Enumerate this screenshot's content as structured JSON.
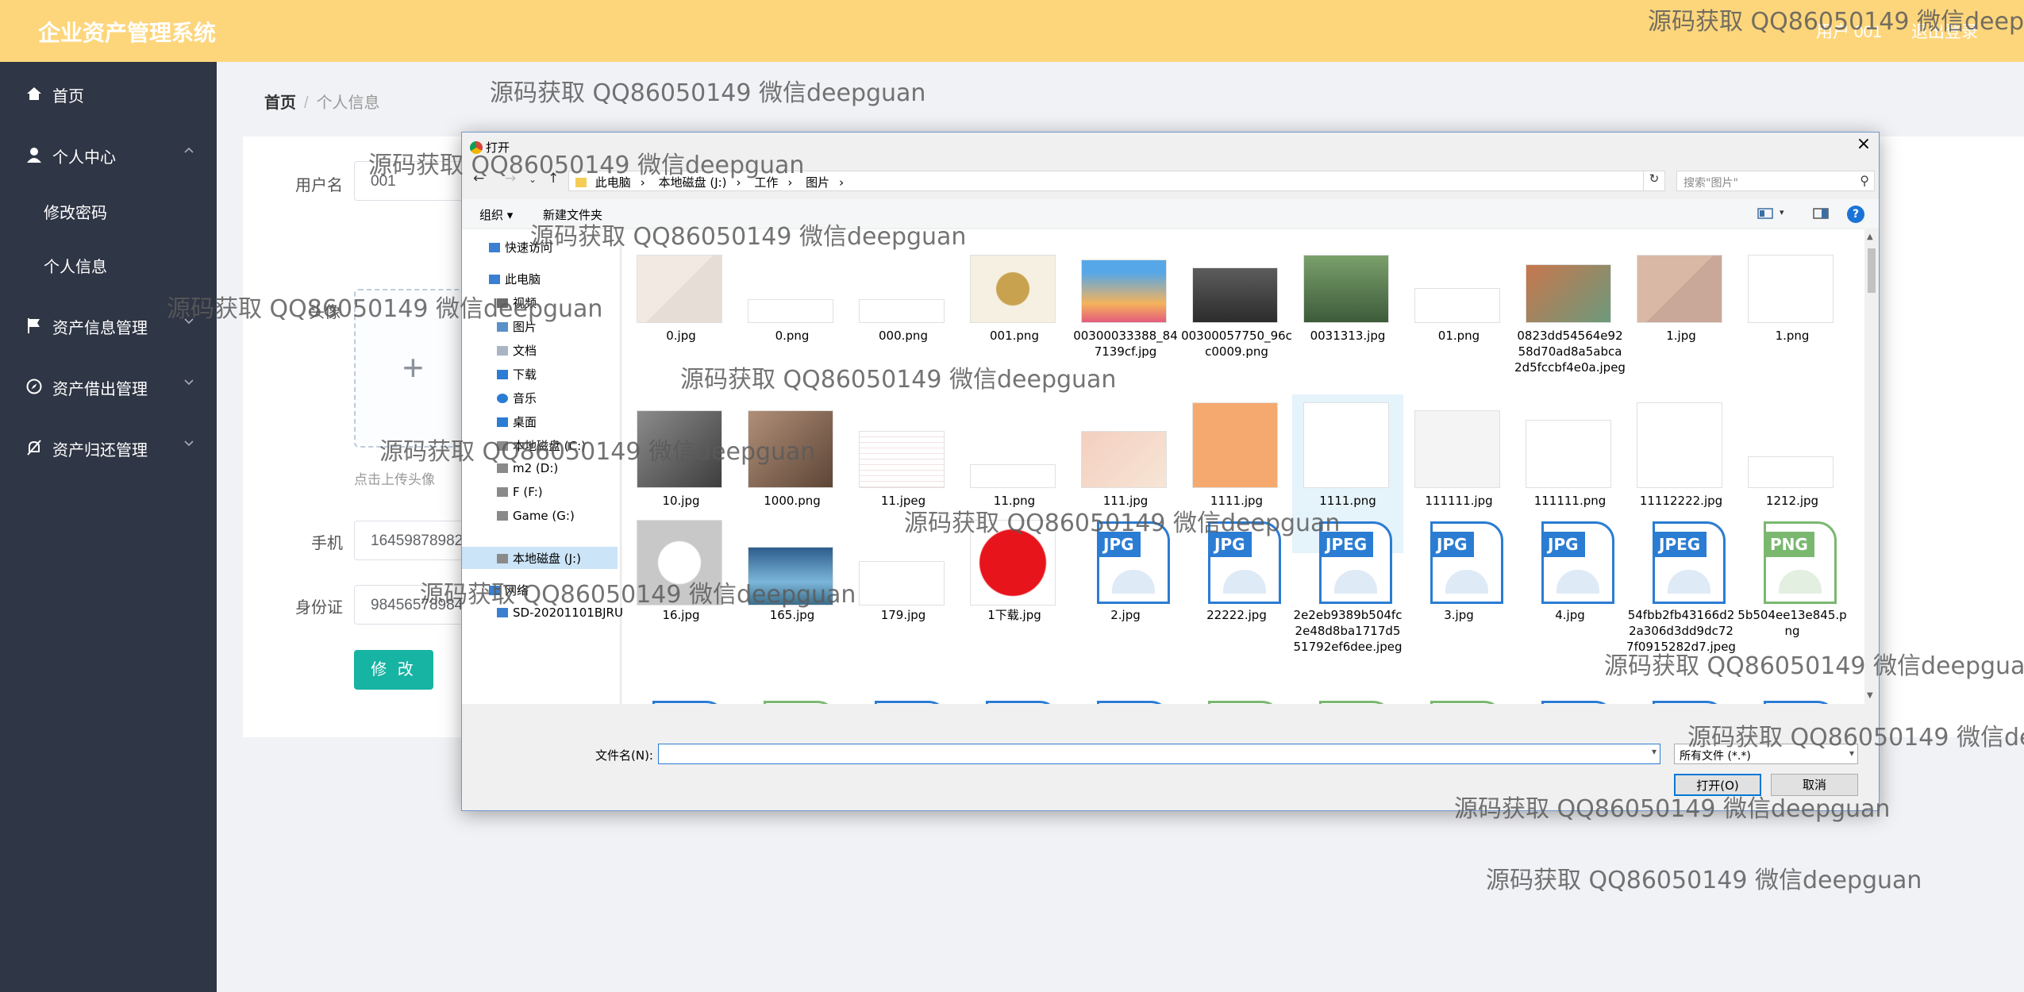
{
  "header": {
    "title": "企业资产管理系统",
    "user": "用户 001",
    "logout": "退出登录"
  },
  "sidebar": {
    "items": [
      {
        "label": "首页"
      },
      {
        "label": "个人中心"
      },
      {
        "label": "修改密码"
      },
      {
        "label": "个人信息"
      },
      {
        "label": "资产信息管理"
      },
      {
        "label": "资产借出管理"
      },
      {
        "label": "资产归还管理"
      }
    ]
  },
  "breadcrumb": {
    "home": "首页",
    "separator": "/",
    "current": "个人信息"
  },
  "form": {
    "username_label": "用户名",
    "username_value": "001",
    "avatar_label": "头像",
    "upload_tip": "点击上传头像",
    "phone_label": "手机",
    "phone_value": "16459878982",
    "id_label": "身份证",
    "id_value": "98456578984",
    "submit_label": "修 改"
  },
  "dialog": {
    "title": "打开",
    "close": "×",
    "path": [
      "此电脑",
      "本地磁盘 (J:)",
      "工作",
      "图片"
    ],
    "search_placeholder": "搜索\"图片\"",
    "toolbar": {
      "organize": "组织 ▾",
      "new_folder": "新建文件夹"
    },
    "nav_pane": [
      {
        "label": "快速访问",
        "icon": "star"
      },
      {
        "label": "此电脑",
        "icon": "computer"
      },
      {
        "label": "视频",
        "icon": "video"
      },
      {
        "label": "图片",
        "icon": "picture"
      },
      {
        "label": "文档",
        "icon": "document"
      },
      {
        "label": "下载",
        "icon": "download"
      },
      {
        "label": "音乐",
        "icon": "music"
      },
      {
        "label": "桌面",
        "icon": "desktop"
      },
      {
        "label": "本地磁盘 (C:)",
        "icon": "drive"
      },
      {
        "label": "m2 (D:)",
        "icon": "drive"
      },
      {
        "label": "F (F:)",
        "icon": "drive"
      },
      {
        "label": "Game (G:)",
        "icon": "drive"
      },
      {
        "label": "本地磁盘 (J:)",
        "icon": "drive"
      },
      {
        "label": "网络",
        "icon": "network"
      },
      {
        "label": "SD-20201101BJRU",
        "icon": "network-computer"
      }
    ],
    "files": [
      {
        "name": "0.jpg",
        "kind": "photo"
      },
      {
        "name": "0.png",
        "kind": "photo"
      },
      {
        "name": "000.png",
        "kind": "photo"
      },
      {
        "name": "001.png",
        "kind": "photo"
      },
      {
        "name": "00300033388_847139cf.jpg",
        "kind": "photo"
      },
      {
        "name": "00300057750_96cc0009.png",
        "kind": "photo"
      },
      {
        "name": "0031313.jpg",
        "kind": "photo"
      },
      {
        "name": "01.png",
        "kind": "photo"
      },
      {
        "name": "0823dd54564e9258d70ad8a5abca2d5fccbf4e0a.jpeg",
        "kind": "photo"
      },
      {
        "name": "1.jpg",
        "kind": "photo"
      },
      {
        "name": "1.png",
        "kind": "photo"
      },
      {
        "name": "10.jpg",
        "kind": "photo"
      },
      {
        "name": "1000.png",
        "kind": "photo"
      },
      {
        "name": "11.jpeg",
        "kind": "photo"
      },
      {
        "name": "11.png",
        "kind": "photo"
      },
      {
        "name": "111.jpg",
        "kind": "photo"
      },
      {
        "name": "1111.jpg",
        "kind": "photo"
      },
      {
        "name": "1111.png",
        "kind": "photo"
      },
      {
        "name": "111111.jpg",
        "kind": "photo"
      },
      {
        "name": "111111.png",
        "kind": "photo"
      },
      {
        "name": "11112222.jpg",
        "kind": "photo"
      },
      {
        "name": "1212.jpg",
        "kind": "photo"
      },
      {
        "name": "16.jpg",
        "kind": "photo"
      },
      {
        "name": "165.jpg",
        "kind": "photo"
      },
      {
        "name": "179.jpg",
        "kind": "photo"
      },
      {
        "name": "1下载.jpg",
        "kind": "photo"
      },
      {
        "name": "2.jpg",
        "kind": "JPG"
      },
      {
        "name": "22222.jpg",
        "kind": "JPG"
      },
      {
        "name": "2e2eb9389b504fc2e48d8ba1717d551792ef6dee.jpeg",
        "kind": "JPEG"
      },
      {
        "name": "3.jpg",
        "kind": "JPG"
      },
      {
        "name": "4.jpg",
        "kind": "JPG"
      },
      {
        "name": "54fbb2fb43166d22a306d3dd9dc727f0915282d7.jpeg",
        "kind": "JPEG"
      },
      {
        "name": "5b504ee13e845.png",
        "kind": "PNG"
      },
      {
        "name": "",
        "kind": "JPEG"
      },
      {
        "name": "",
        "kind": "PNG"
      },
      {
        "name": "",
        "kind": "JPEG"
      },
      {
        "name": "",
        "kind": "JPEG"
      },
      {
        "name": "",
        "kind": "JPG"
      },
      {
        "name": "",
        "kind": "PNG"
      },
      {
        "name": "",
        "kind": "PNG"
      },
      {
        "name": "",
        "kind": "PNG"
      },
      {
        "name": "",
        "kind": "JPEG"
      },
      {
        "name": "",
        "kind": "JPG"
      },
      {
        "name": "",
        "kind": "JPEG"
      }
    ],
    "filename_label": "文件名(N):",
    "filename_value": "",
    "filetype": "所有文件 (*.*)",
    "open": "打开(O)",
    "cancel": "取消"
  },
  "watermark": "源码获取 QQ86050149 微信deepguan",
  "colors": {
    "header": "#fdd67c",
    "sidebar": "#2f3645",
    "primary_button": "#17b3a3",
    "jpg_icon": "#2b7cd3",
    "png_icon": "#7ab870"
  }
}
